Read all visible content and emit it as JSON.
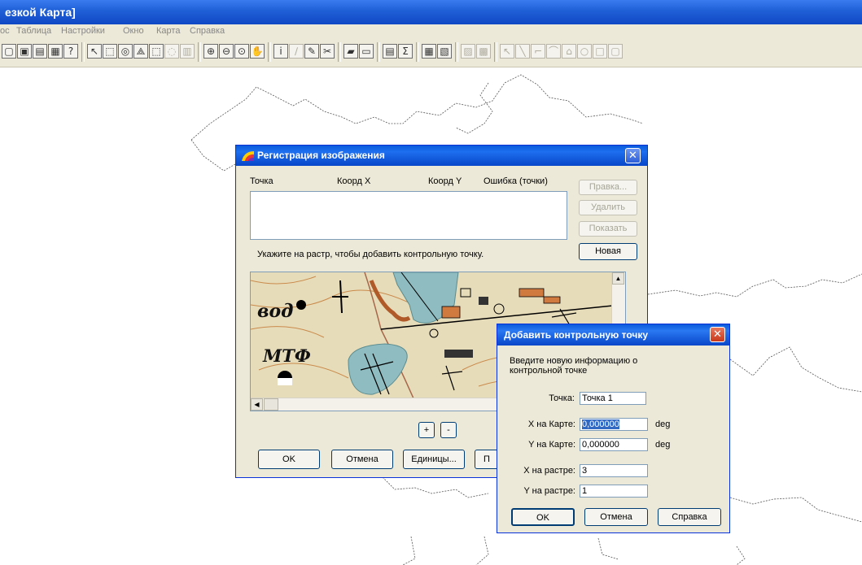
{
  "app": {
    "title": "езкой Карта]"
  },
  "menu": [
    "ос",
    "Таблица",
    "Настройки",
    "Окно",
    "Карта",
    "Справка"
  ],
  "toolbar": {
    "icons": [
      "window-icon",
      "browser-icon",
      "table-icon",
      "layout-icon",
      "help-pointer-icon",
      "select-arrow-icon",
      "marquee-select-icon",
      "radius-select-icon",
      "polygon-select-icon",
      "boundary-select-icon",
      "unselect-icon",
      "graph-select-icon",
      "zoom-in-icon",
      "zoom-out-icon",
      "change-view-icon",
      "grabber-icon",
      "info-icon",
      "ruler-icon",
      "label-icon",
      "hotlink-icon",
      "drag-window-icon",
      "legend-icon",
      "statistics-icon",
      "sum-icon",
      "layer-control-icon",
      "map-window-icon",
      "clip-region-icon",
      "set-target-icon",
      "symbol-icon",
      "line-icon",
      "polyline-icon",
      "arc-icon",
      "polygon-icon",
      "ellipse-icon",
      "rectangle-icon",
      "rounded-rect-icon"
    ],
    "glyphs": [
      "▢",
      "▣",
      "▤",
      "▦",
      "?",
      "↖",
      "⬚",
      "◎",
      "⟁",
      "⬚",
      "◌",
      "▥",
      "⊕",
      "⊖",
      "⊙",
      "✋",
      "i",
      "∕",
      "✎",
      "✂",
      "▰",
      "▭",
      "▤",
      "Σ",
      "▦",
      "▧",
      "▨",
      "▩",
      "↖",
      "╲",
      "⌐",
      "⌒",
      "⌂",
      "○",
      "□",
      "▢"
    ]
  },
  "dialog_registration": {
    "title": "Регистрация изображения",
    "columns": [
      "Точка",
      "Коорд X",
      "Коорд Y",
      "Ошибка (точки)"
    ],
    "buttons": {
      "edit": "Правка...",
      "delete": "Удалить",
      "show": "Показать",
      "new": "Новая"
    },
    "hint": "Укажите на растр, чтобы добавить контрольную точку.",
    "raster_labels": [
      "вод",
      "МТФ"
    ],
    "zoom_in": "+",
    "zoom_out": "-",
    "ok": "OK",
    "cancel": "Отмена",
    "units": "Единицы...",
    "partial_button": "П"
  },
  "dialog_add_point": {
    "title": "Добавить контрольную точку",
    "description": "Введите новую информацию о контрольной точке",
    "fields": {
      "point": {
        "label": "Точка:",
        "value": "Точка 1"
      },
      "x_map": {
        "label": "X на Карте:",
        "value": "0,000000",
        "unit": "deg"
      },
      "y_map": {
        "label": "Y на Карте:",
        "value": "0,000000",
        "unit": "deg"
      },
      "x_raster": {
        "label": "X на растре:",
        "value": "3"
      },
      "y_raster": {
        "label": "Y на растре:",
        "value": "1"
      }
    },
    "ok": "OK",
    "cancel": "Отмена",
    "help": "Справка"
  },
  "colors": {
    "xp_blue": "#0a5bdc",
    "dialog_face": "#ece9d8",
    "close_red": "#c9381a"
  }
}
